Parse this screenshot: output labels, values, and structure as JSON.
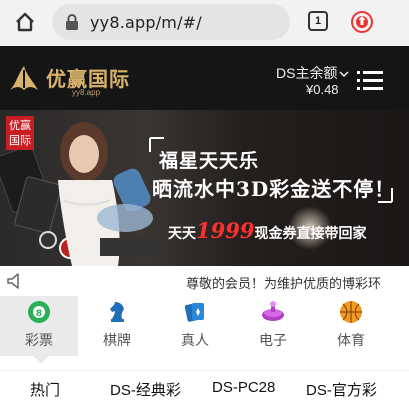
{
  "browser": {
    "url": "yy8.app/m/#/",
    "tab_count": "1",
    "home_icon": "home-icon",
    "lock_icon": "lock-icon",
    "extension_icon": "upload-icon"
  },
  "header": {
    "logo_title": "优赢国际",
    "logo_sub": "yy8.app",
    "balance_label": "DS主余额",
    "balance_value": "¥0.48",
    "menu_icon": "hamburger-icon"
  },
  "banner": {
    "badge": "优赢国际",
    "line1": "福星天天乐",
    "line2": "晒流水中3D彩金送不停！",
    "line3_prefix": "天天",
    "line3_amount": "1999",
    "line3_suffix": "现金券直接带回家"
  },
  "notice": {
    "text": "尊敬的会员！为维护优质的博彩环"
  },
  "categories": [
    {
      "label": "彩票",
      "icon": "lottery-ball-icon",
      "active": true
    },
    {
      "label": "棋牌",
      "icon": "chess-knight-icon",
      "active": false
    },
    {
      "label": "真人",
      "icon": "playing-cards-icon",
      "active": false
    },
    {
      "label": "电子",
      "icon": "slot-machine-icon",
      "active": false
    },
    {
      "label": "体育",
      "icon": "basketball-icon",
      "active": false
    }
  ],
  "game_tabs": [
    {
      "label": "热门"
    },
    {
      "label": "DS-经典彩"
    },
    {
      "label": "DS-PC28"
    },
    {
      "label": "DS-官方彩"
    }
  ],
  "colors": {
    "header_bg": "#151515",
    "gold": "#d7b36b",
    "accent_red": "#ff3030"
  }
}
